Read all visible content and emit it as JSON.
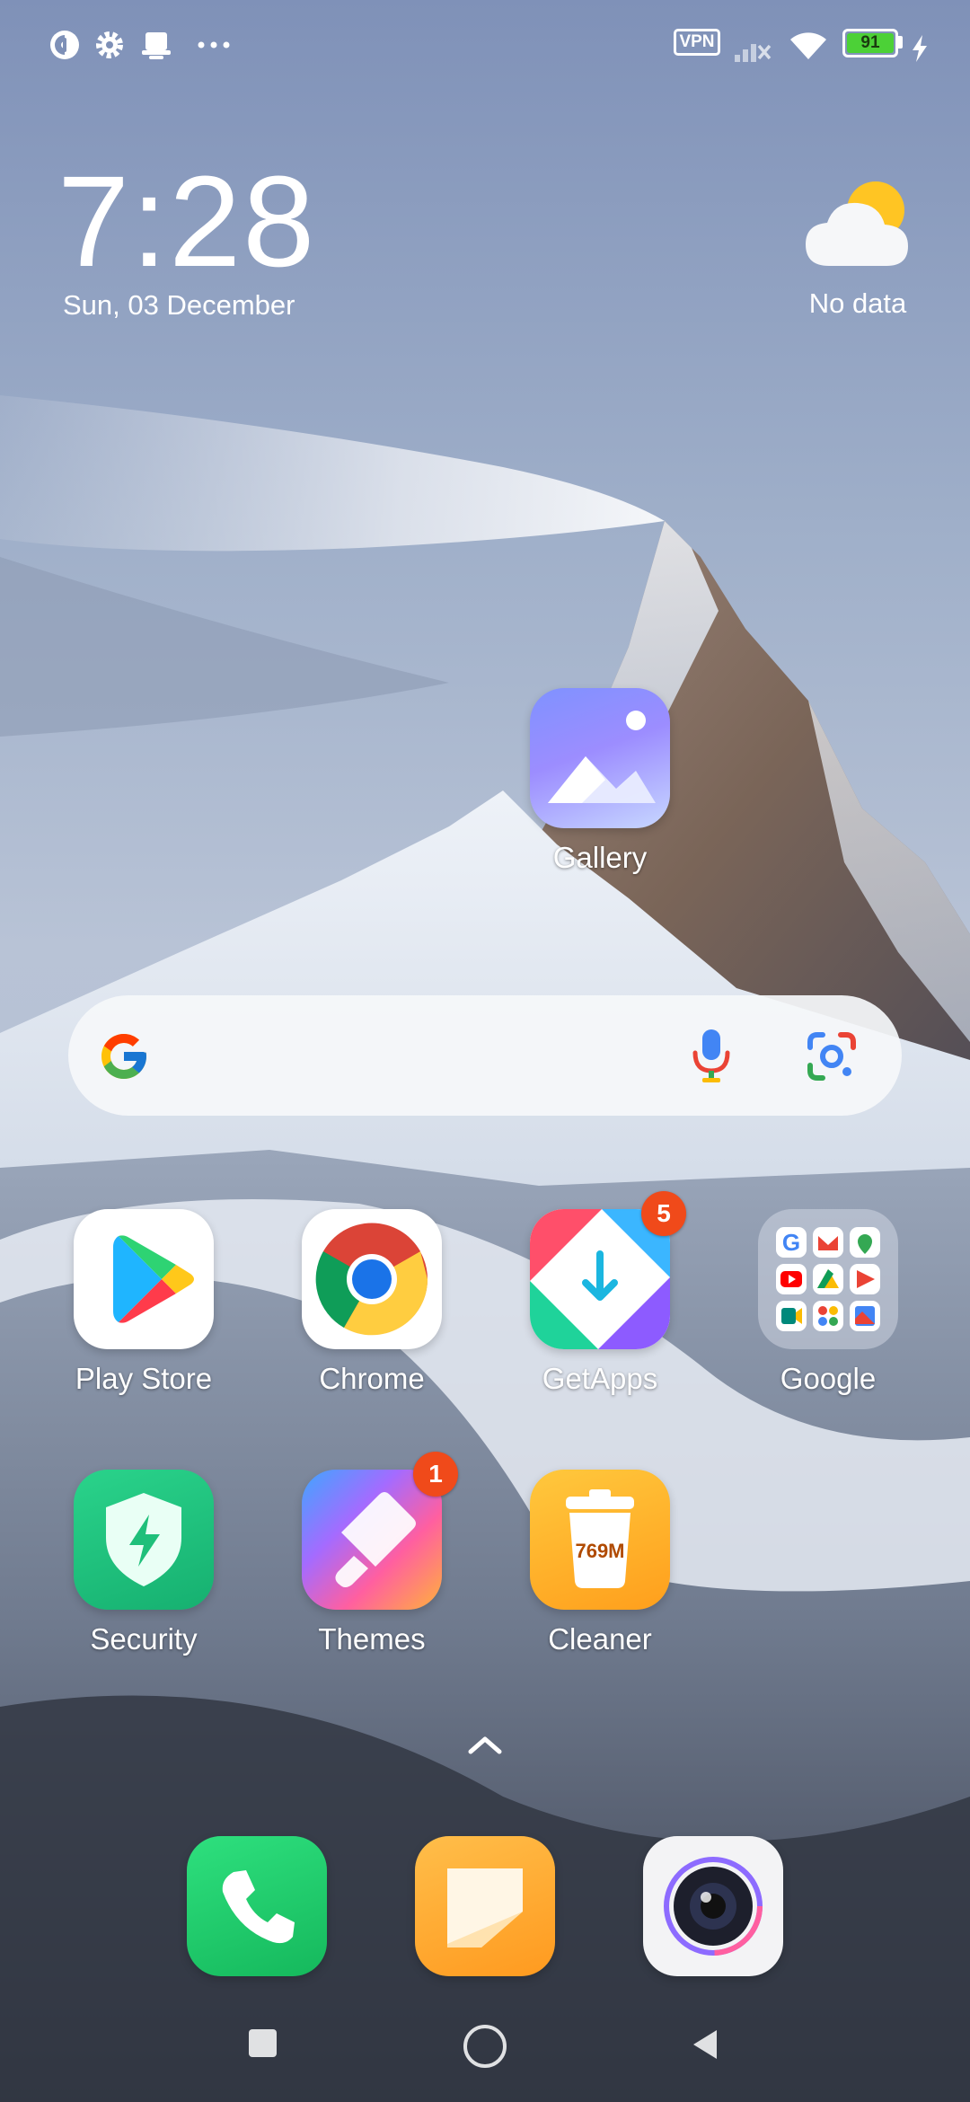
{
  "status_bar": {
    "left_icons": [
      "data-saver-icon",
      "settings-icon",
      "notification-icon",
      "more-icon"
    ],
    "vpn_label": "VPN",
    "battery_level": "91",
    "right_icons": [
      "signal-off-icon",
      "wifi-icon",
      "charging-icon"
    ]
  },
  "clock": {
    "time": "7:28",
    "date": "Sun, 03 December"
  },
  "weather": {
    "label": "No data",
    "icon": "partly-cloudy-icon"
  },
  "gallery": {
    "label": "Gallery"
  },
  "search": {
    "logo": "google-g-icon",
    "voice_icon": "mic-icon",
    "lens_icon": "lens-icon"
  },
  "apps": {
    "play_store": {
      "label": "Play Store"
    },
    "chrome": {
      "label": "Chrome"
    },
    "getapps": {
      "label": "GetApps",
      "badge": "5"
    },
    "google_folder": {
      "label": "Google"
    },
    "security": {
      "label": "Security"
    },
    "themes": {
      "label": "Themes",
      "badge": "1"
    },
    "cleaner": {
      "label": "Cleaner",
      "icon_text": "769M"
    }
  },
  "dock": [
    "phone-icon",
    "notes-icon",
    "camera-icon"
  ],
  "nav": [
    "recents-button",
    "home-button",
    "back-button"
  ],
  "colors": {
    "badge": "#f04a1a",
    "battery": "#4cd137",
    "security": "#1fbf7a",
    "phone": "#22c36a",
    "notes": "#ffa934",
    "cleaner": "#ffb52e"
  }
}
